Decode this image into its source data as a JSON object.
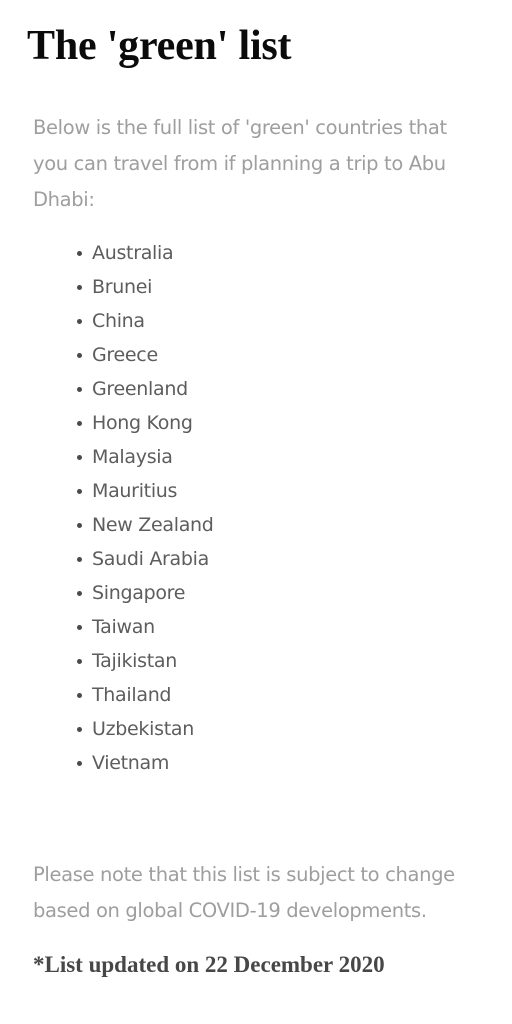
{
  "article": {
    "heading": "The 'green' list",
    "intro_paragraph": "Below is the full list of 'green' countries that you can travel from if planning a trip to Abu Dhabi:",
    "note_paragraph": "Please note that this list is subject to change based on global COVID-19 developments.",
    "updated_line": "*List updated on 22 December 2020",
    "countries": [
      "Australia",
      "Brunei",
      "China",
      "Greece",
      "Greenland",
      "Hong Kong",
      "Malaysia",
      "Mauritius",
      "New Zealand",
      "Saudi Arabia",
      "Singapore",
      "Taiwan",
      "Tajikistan",
      "Thailand",
      "Uzbekistan",
      "Vietnam"
    ]
  },
  "colors": {
    "background": "#ffffff",
    "heading_text": "#0b0b0b",
    "muted_text": "#9e9e9e",
    "list_text": "#5d5d5d",
    "bullet": "#4a4a4a",
    "updated_text": "#474747"
  }
}
